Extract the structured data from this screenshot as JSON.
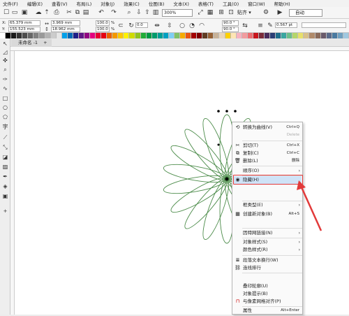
{
  "menubar": {
    "items": [
      "文件(F)",
      "编辑(E)",
      "查看(V)",
      "布局(L)",
      "对象(J)",
      "效果(C)",
      "位图(B)",
      "文本(X)",
      "表格(T)",
      "工具(O)",
      "窗口(W)",
      "帮助(H)"
    ]
  },
  "toolbar": {
    "zoom": "300%",
    "snap_label": "贴齐",
    "auto_label": "自动"
  },
  "propbar": {
    "x": "65.379 mm",
    "y": "155.523 mm",
    "w": "3.969 mm",
    "h": "18.962 mm",
    "scale_x": "100.0",
    "scale_y": "100.0",
    "pct": "%",
    "rotation": "0.0",
    "angle1": "90.0 °",
    "angle2": "90.0 °",
    "outline": "0.567 pt",
    "x_label": "X:",
    "y_label": "Y:"
  },
  "tab": {
    "label": "未命名 -1",
    "add": "+"
  },
  "context_menu": {
    "items": [
      {
        "label": "转换为曲线(V)",
        "shortcut": "Ctrl+Q",
        "icon": "convert-curve-icon"
      },
      {
        "label": "",
        "shortcut": "Delete"
      },
      {
        "label": "剪切(T)",
        "shortcut": "Ctrl+X",
        "icon": "scissors-icon"
      },
      {
        "label": "复制(C)",
        "shortcut": "Ctrl+C",
        "icon": "copy-icon"
      },
      {
        "label": "删除(L)",
        "shortcut": "删除",
        "icon": "delete-icon"
      },
      {
        "label": "顺序(O)",
        "arrow": "›"
      },
      {
        "label": "隐藏(H)",
        "icon": "hide-icon"
      },
      {
        "label": "框类型(E)",
        "arrow": "›"
      },
      {
        "label": "创建新对象(B)",
        "shortcut": "Alt+S",
        "icon": "new-object-icon"
      },
      {
        "label": "因特网链接(N)",
        "arrow": "›"
      },
      {
        "label": "对象样式(S)",
        "arrow": "›"
      },
      {
        "label": "颜色样式(R)",
        "arrow": "›"
      },
      {
        "label": "段落文本换行(W)",
        "icon": "wrap-icon"
      },
      {
        "label": "连线排行",
        "icon": "link-icon"
      },
      {
        "label": "叠印轮廓(U)"
      },
      {
        "label": "对象提示(B)"
      },
      {
        "label": "与像素网格对齐(P)",
        "icon": "magnet-icon"
      },
      {
        "label": "属性",
        "shortcut": "Alt+Enter"
      }
    ]
  },
  "colors": {
    "accent": "#e23a3a",
    "flower": "#4c8c4a",
    "highlight": "#cfe3f7"
  },
  "palette": [
    "#ffffff",
    "#000000",
    "#1a1a1a",
    "#333333",
    "#4d4d4d",
    "#666666",
    "#808080",
    "#999999",
    "#b3b3b3",
    "#cccccc",
    "#e6e6e6",
    "#00a0e9",
    "#0068b7",
    "#1d2088",
    "#601986",
    "#920783",
    "#e4007f",
    "#e60033",
    "#e60012",
    "#eb6100",
    "#f39800",
    "#fcc800",
    "#fff100",
    "#cfdb00",
    "#8fc31f",
    "#22ac38",
    "#009944",
    "#009b6b",
    "#009e96",
    "#00a0c1",
    "#7ecef4",
    "#80c269",
    "#f6ab00",
    "#e95513",
    "#a40000",
    "#7d0000",
    "#5f3c23",
    "#956134",
    "#c7b299",
    "#ead5b9",
    "#fdd000",
    "#ffe5b4",
    "#f7b2c0",
    "#f29c9f",
    "#ec6d71",
    "#c9161d",
    "#7b2c3a",
    "#4a2c5c",
    "#2c3e75",
    "#1f6e8c",
    "#3aa6a0",
    "#6dbf8a",
    "#b4d66a",
    "#e8e06a",
    "#d8c08a",
    "#b08a6a",
    "#8a6a5a",
    "#6a5a6a",
    "#5a6a8a",
    "#4a7aa0",
    "#70a0c0",
    "#a0c8e0"
  ]
}
